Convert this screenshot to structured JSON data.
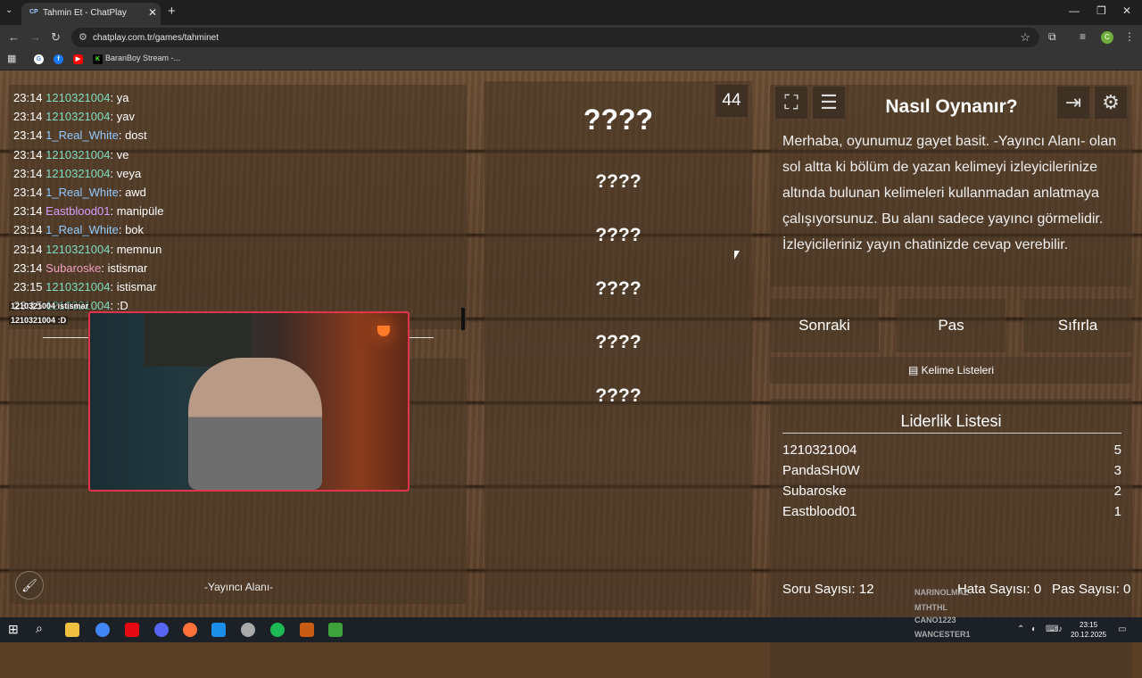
{
  "browser": {
    "tab_title": "Tahmin Et - ChatPlay",
    "tab_favicon": "CP",
    "url": "chatplay.com.tr/games/tahminet",
    "profile_initial": "C",
    "bookmarks": [
      {
        "label": "",
        "icon": "google-icon"
      },
      {
        "label": "",
        "icon": "facebook-icon"
      },
      {
        "label": "",
        "icon": "youtube-icon"
      },
      {
        "label": "BaranBoy Stream -...",
        "icon": "kick-icon"
      }
    ]
  },
  "chat": {
    "messages": [
      {
        "time": "23:14",
        "user": "1210321004",
        "text": "ya",
        "color": "#7fdcc0"
      },
      {
        "time": "23:14",
        "user": "1210321004",
        "text": "yav",
        "color": "#7fdcc0"
      },
      {
        "time": "23:14",
        "user": "1_Real_White",
        "text": "dost",
        "color": "#8fc9ff"
      },
      {
        "time": "23:14",
        "user": "1210321004",
        "text": "ve",
        "color": "#7fdcc0"
      },
      {
        "time": "23:14",
        "user": "1210321004",
        "text": "veya",
        "color": "#7fdcc0"
      },
      {
        "time": "23:14",
        "user": "1_Real_White",
        "text": "awd",
        "color": "#8fc9ff"
      },
      {
        "time": "23:14",
        "user": "Eastblood01",
        "text": "manipüle",
        "color": "#d99cff"
      },
      {
        "time": "23:14",
        "user": "1_Real_White",
        "text": "bok",
        "color": "#8fc9ff"
      },
      {
        "time": "23:14",
        "user": "1210321004",
        "text": "memnun",
        "color": "#7fdcc0"
      },
      {
        "time": "23:14",
        "user": "Subaroske",
        "text": "istismar",
        "color": "#f0a0c0"
      },
      {
        "time": "23:15",
        "user": "1210321004",
        "text": "istismar",
        "color": "#7fdcc0"
      },
      {
        "time": "23:15",
        "user": "1210321004",
        "text": ":D",
        "color": "#7fdcc0"
      }
    ],
    "overlay": [
      {
        "user": "1210321004",
        "text": "istismar"
      },
      {
        "user": "1210321004",
        "text": ":D"
      }
    ]
  },
  "streamer_area_label": "-Yayıncı Alanı-",
  "game": {
    "counter": "44",
    "words": [
      "????",
      "????",
      "????",
      "????",
      "????",
      "????"
    ]
  },
  "info": {
    "title": "Nasıl Oynanır?",
    "text": "Merhaba, oyunumuz gayet basit. -Yayıncı Alanı- olan sol altta ki bölüm de yazan kelimeyi izleyicilerinize altında bulunan kelimeleri kullanmadan anlatmaya çalışıyorsunuz. Bu alanı sadece yayıncı görmelidir. İzleyicileriniz yayın chatinizde cevap verebilir."
  },
  "controls": {
    "next": "Sonraki",
    "pass": "Pas",
    "reset": "Sıfırla",
    "word_lists": "Kelime Listeleri"
  },
  "leaderboard": {
    "title": "Liderlik Listesi",
    "rows": [
      {
        "name": "1210321004",
        "score": "5"
      },
      {
        "name": "PandaSH0W",
        "score": "3"
      },
      {
        "name": "Subaroske",
        "score": "2"
      },
      {
        "name": "Eastblood01",
        "score": "1"
      }
    ]
  },
  "stats": {
    "questions": "Soru Sayısı: 12",
    "errors": "Hata Sayısı: 0",
    "passes": "Pas Sayısı: 0"
  },
  "ghost_names": [
    "NARINOLMAZ",
    "MTHTHL",
    "CANO1223",
    "WANCESTER1"
  ],
  "taskbar": {
    "time": "23:15",
    "date": "20.12.2025"
  }
}
